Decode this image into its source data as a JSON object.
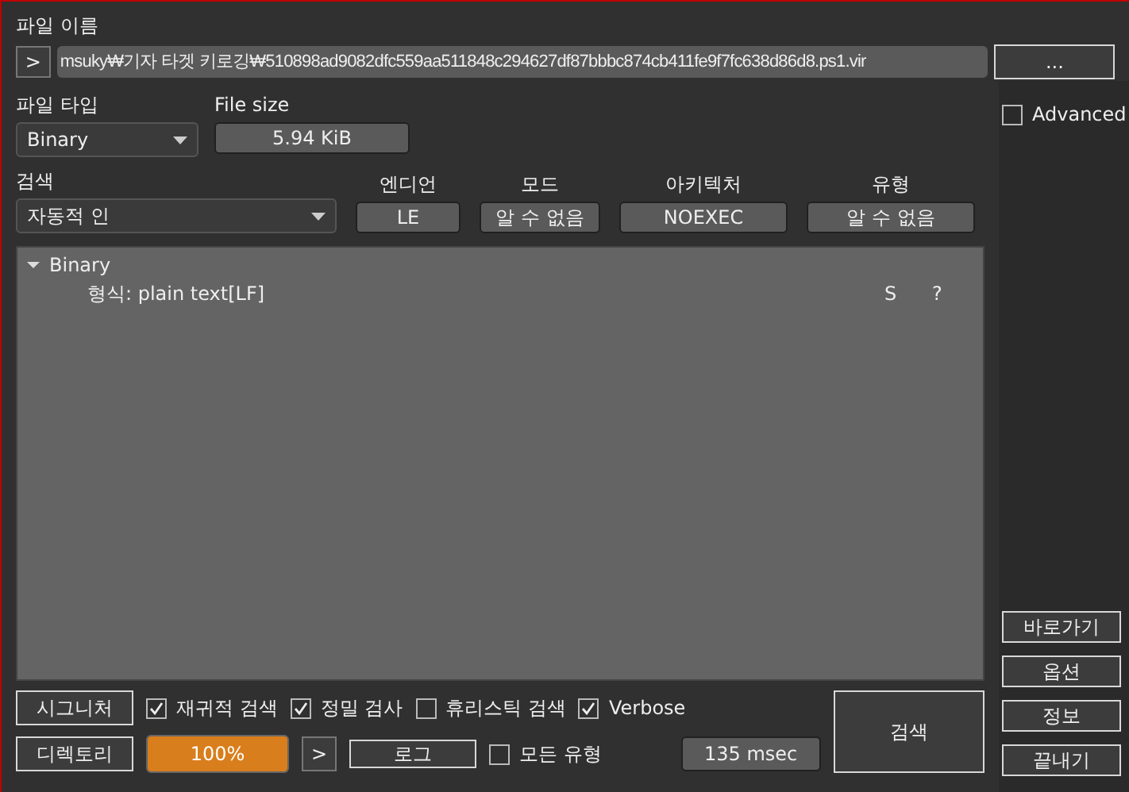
{
  "file_name": {
    "label": "파일 이름",
    "expand_button": ">",
    "value": "msuky₩기자 타겟 키로깅₩510898ad9082dfc559aa511848c294627df87bbbc874cb411fe9f7fc638d86d8.ps1.vir",
    "browse_button": "..."
  },
  "file_type": {
    "label": "파일 타입",
    "value": "Binary"
  },
  "file_size": {
    "label": "File size",
    "value": "5.94 KiB"
  },
  "advanced": {
    "label": "Advanced",
    "checked": false
  },
  "scan": {
    "label": "검색",
    "value": "자동적 인"
  },
  "info_fields": [
    {
      "label": "엔디언",
      "value": "LE"
    },
    {
      "label": "모드",
      "value": "알 수 없음"
    },
    {
      "label": "아키텍처",
      "value": "NOEXEC"
    },
    {
      "label": "유형",
      "value": "알 수 없음"
    }
  ],
  "tree": [
    {
      "label": "Binary",
      "expanded": true,
      "children": [
        {
          "label": "형식: plain text[LF]",
          "column_2": "S",
          "column_3": "?"
        }
      ]
    }
  ],
  "options": [
    {
      "label": "재귀적 검색",
      "checked": true
    },
    {
      "label": "정밀 검사",
      "checked": true
    },
    {
      "label": "휴리스틱 검색",
      "checked": false
    },
    {
      "label": "Verbose",
      "checked": true
    }
  ],
  "signature_button": "시그니처",
  "directory_button": "디렉토리",
  "progress": {
    "level": 1,
    "text": "100%"
  },
  "next_button": ">",
  "log_button": "로그",
  "all_types": {
    "label": "모든 유형",
    "checked": false
  },
  "elapsed": "135 msec",
  "scan_button": "검색",
  "side_buttons": [
    "바로가기",
    "옵션",
    "정보",
    "끝내기"
  ]
}
